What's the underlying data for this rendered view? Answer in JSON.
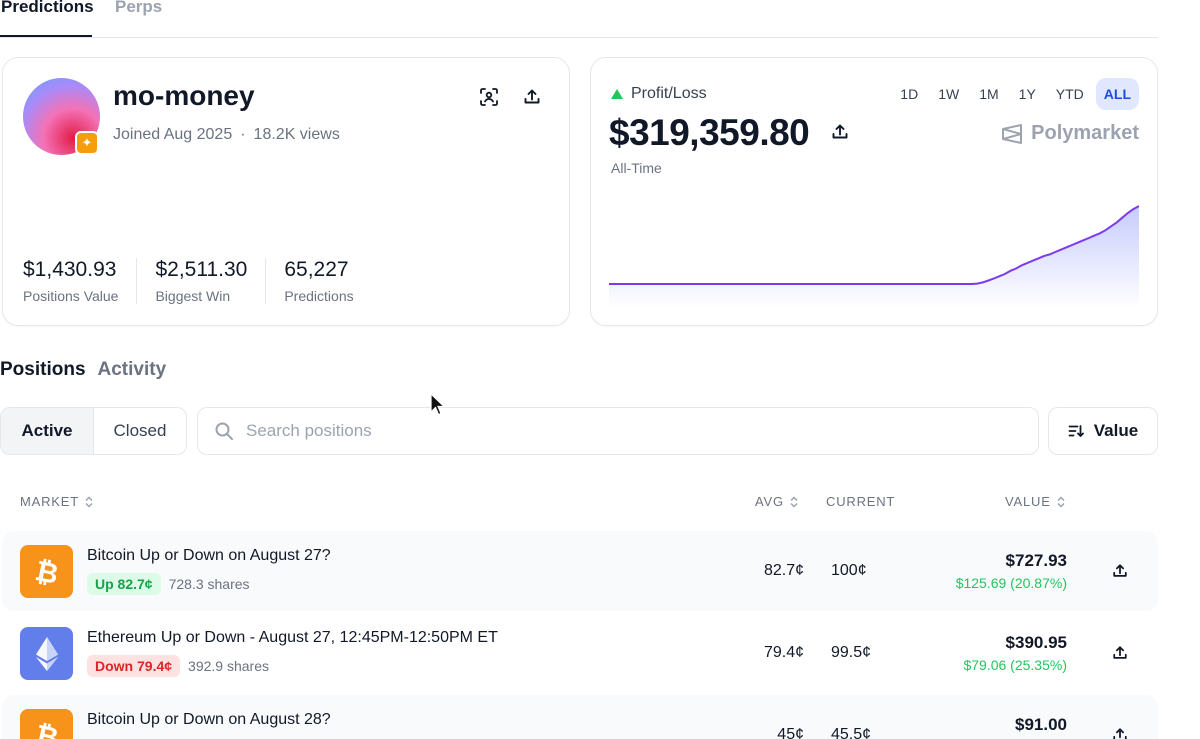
{
  "top_tabs": [
    {
      "label": "Predictions",
      "active": true
    },
    {
      "label": "Perps",
      "active": false
    }
  ],
  "profile": {
    "username": "mo-money",
    "joined": "Joined Aug 2025",
    "separator": "·",
    "views": "18.2K views",
    "badge_icon": "plus-badge-icon",
    "stats": [
      {
        "value": "$1,430.93",
        "label": "Positions Value"
      },
      {
        "value": "$2,511.30",
        "label": "Biggest Win"
      },
      {
        "value": "65,227",
        "label": "Predictions"
      }
    ]
  },
  "pnl": {
    "label": "Profit/Loss",
    "value": "$319,359.80",
    "sub": "All-Time",
    "ranges": [
      "1D",
      "1W",
      "1M",
      "1Y",
      "YTD",
      "ALL"
    ],
    "active_range": "ALL",
    "brand": "Polymarket",
    "indicator_color": "#22c55e",
    "line_color": "#7c3aed",
    "fill_color": "#818cf8",
    "series": [
      0,
      0,
      0,
      0,
      0,
      0,
      0,
      0,
      0,
      0,
      0,
      0,
      0,
      0,
      0,
      0,
      0,
      0,
      0,
      0,
      0,
      0,
      0,
      0,
      0,
      0,
      0,
      0,
      0,
      0,
      0,
      0,
      0,
      0,
      0,
      0,
      0,
      0,
      0,
      0,
      0,
      0,
      0,
      0,
      0,
      0,
      0,
      0,
      0,
      0,
      0,
      0,
      0,
      0,
      0,
      0,
      0,
      0,
      0,
      0,
      0,
      0,
      0,
      0,
      0,
      0,
      0.005,
      0.02,
      0.045,
      0.07,
      0.1,
      0.13,
      0.17,
      0.2,
      0.24,
      0.27,
      0.3,
      0.33,
      0.36,
      0.38,
      0.41,
      0.44,
      0.47,
      0.5,
      0.53,
      0.56,
      0.59,
      0.62,
      0.65,
      0.69,
      0.74,
      0.79,
      0.85,
      0.91,
      0.96,
      1.0
    ]
  },
  "positions_tabs": [
    {
      "label": "Positions",
      "active": true
    },
    {
      "label": "Activity",
      "active": false
    }
  ],
  "filter": {
    "active": "Active",
    "closed": "Closed"
  },
  "search": {
    "placeholder": "Search positions"
  },
  "sort": {
    "label": "Value"
  },
  "columns": {
    "market": "MARKET",
    "avg": "AVG",
    "current": "CURRENT",
    "value": "VALUE"
  },
  "rows": [
    {
      "coin": "bitcoin-icon",
      "title": "Bitcoin Up or Down on August 27?",
      "side": "Up 82.7¢",
      "side_type": "up",
      "shares": "728.3 shares",
      "avg": "82.7¢",
      "current": "100¢",
      "value": "$727.93",
      "change": "$125.69 (20.87%)"
    },
    {
      "coin": "ethereum-icon",
      "title": "Ethereum Up or Down - August 27, 12:45PM-12:50PM ET",
      "side": "Down 79.4¢",
      "side_type": "down",
      "shares": "392.9 shares",
      "avg": "79.4¢",
      "current": "99.5¢",
      "value": "$390.95",
      "change": "$79.06 (25.35%)"
    },
    {
      "coin": "bitcoin-icon",
      "title": "Bitcoin Up or Down on August 28?",
      "side": "",
      "side_type": "down",
      "shares": "",
      "avg": "45¢",
      "current": "45.5¢",
      "value": "$91.00",
      "change": ""
    }
  ]
}
